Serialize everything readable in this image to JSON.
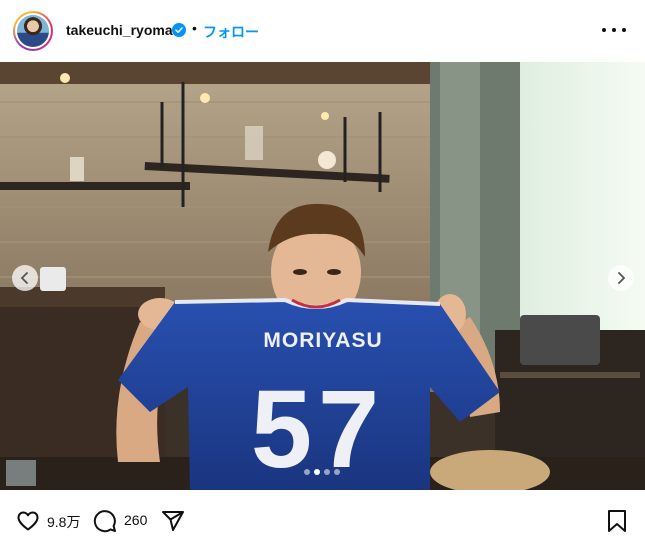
{
  "header": {
    "username": "takeuchi_ryoma",
    "separator": "•",
    "follow_label": "フォロー"
  },
  "post": {
    "jersey_name": "MORIYASU",
    "jersey_number": "57",
    "carousel": {
      "total": 4,
      "active": 2
    }
  },
  "actions": {
    "likes": "9.8万",
    "comments": "260"
  },
  "icons": [
    "verified-badge-icon",
    "more-options-icon",
    "carousel-prev-icon",
    "carousel-next-icon",
    "heart-icon",
    "comment-icon",
    "share-icon",
    "bookmark-icon"
  ],
  "colors": {
    "follow": "#0095f6",
    "verified": "#0095f6",
    "jersey": "#1f3f9a"
  }
}
